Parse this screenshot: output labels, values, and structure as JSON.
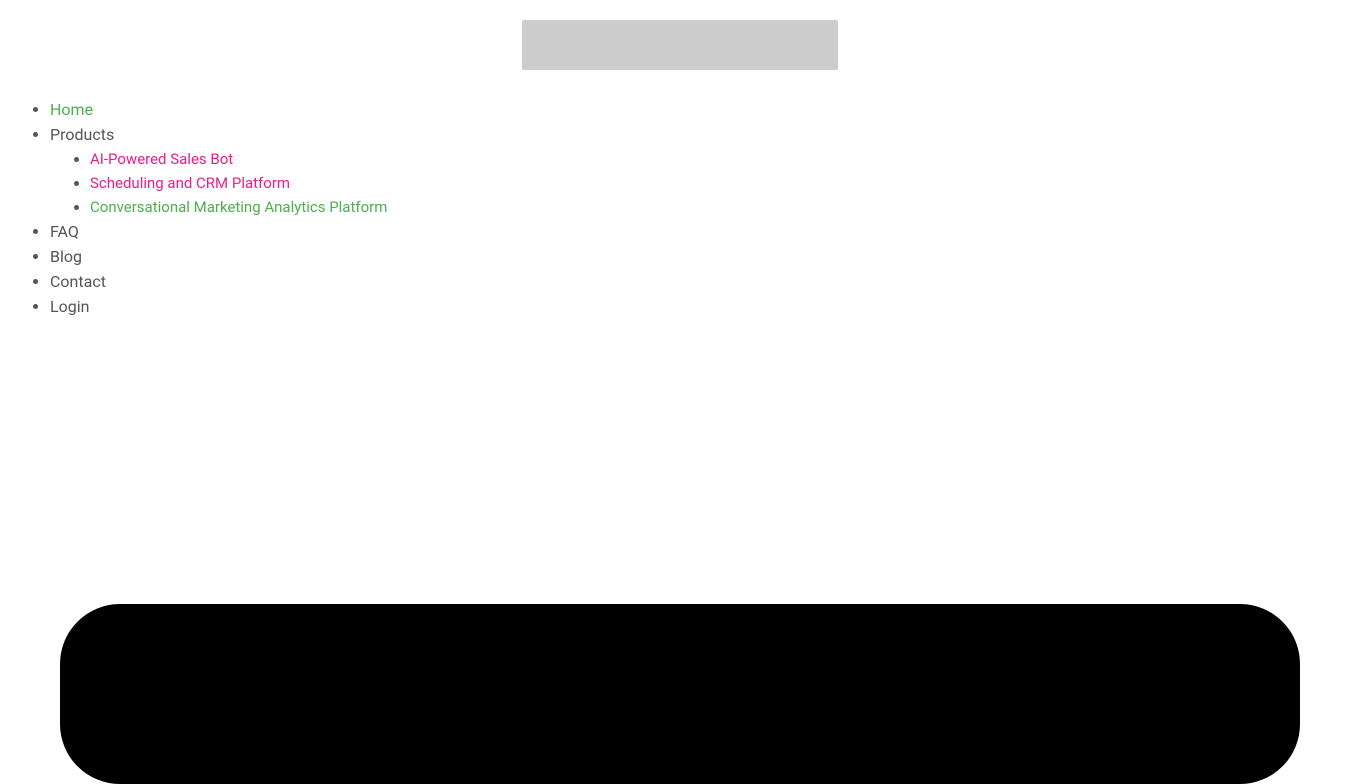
{
  "header": {
    "logo_alt": "Logo"
  },
  "nav": {
    "items": [
      {
        "label": "Home",
        "href": "#",
        "active": true,
        "color": "green",
        "sub_items": []
      },
      {
        "label": "Products",
        "href": "#",
        "active": false,
        "color": "dark",
        "sub_items": [
          {
            "label": "AI-Powered Sales Bot",
            "href": "#",
            "color": "pink"
          },
          {
            "label": "Scheduling and CRM Platform",
            "href": "#",
            "color": "pink"
          },
          {
            "label": "Conversational Marketing Analytics Platform",
            "href": "#",
            "color": "green"
          }
        ]
      },
      {
        "label": "FAQ",
        "href": "#",
        "active": false,
        "color": "dark",
        "sub_items": []
      },
      {
        "label": "Blog",
        "href": "#",
        "active": false,
        "color": "dark",
        "sub_items": []
      },
      {
        "label": "Contact",
        "href": "#",
        "active": false,
        "color": "dark",
        "sub_items": []
      },
      {
        "label": "Login",
        "href": "#",
        "active": false,
        "color": "dark",
        "sub_items": []
      }
    ]
  }
}
